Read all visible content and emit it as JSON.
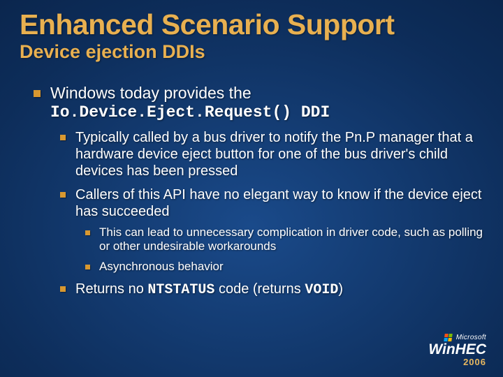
{
  "title": "Enhanced Scenario Support",
  "subtitle": "Device ejection DDIs",
  "bullets": {
    "b1_pre": "Windows today provides the ",
    "b1_code": "Io.Device.Eject.Request()",
    "b1_post": " DDI",
    "b1a": "Typically called by a bus driver to notify the Pn.P manager that a hardware device eject button for one of the bus driver's child devices has been pressed",
    "b1b": "Callers of this API have no elegant way to know if the device eject has succeeded",
    "b1b_i": "This can lead to unnecessary complication in driver code, such as polling or other undesirable workarounds",
    "b1b_ii": "Asynchronous behavior",
    "b1c_pre": "Returns no ",
    "b1c_code1": "NTSTATUS",
    "b1c_mid": " code (returns ",
    "b1c_code2": "VOID",
    "b1c_post": ")"
  },
  "logo": {
    "ms": "Microsoft",
    "brand": "WinHEC",
    "year": "2006"
  }
}
